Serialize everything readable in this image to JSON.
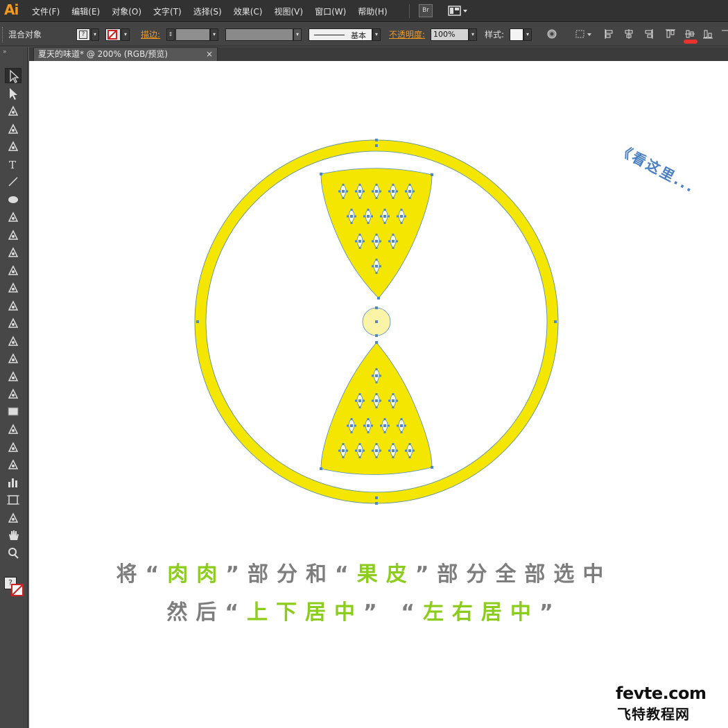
{
  "app": {
    "logo": "Ai",
    "menus": [
      "文件(F)",
      "编辑(E)",
      "对象(O)",
      "文字(T)",
      "选择(S)",
      "效果(C)",
      "视图(V)",
      "窗口(W)",
      "帮助(H)"
    ],
    "bridge_label": "Br"
  },
  "control": {
    "selection_label": "混合对象",
    "stroke_label": "描边:",
    "stroke_profile": "基本",
    "opacity_label": "不透明度:",
    "opacity_value": "100%",
    "style_label": "样式:"
  },
  "document": {
    "tab_title": "夏天的味道* @ 200% (RGB/预览)",
    "close_glyph": "×"
  },
  "tools": [
    "selection",
    "direct-selection",
    "magic-wand",
    "lasso",
    "pen",
    "type",
    "line-segment",
    "ellipse",
    "paintbrush",
    "pencil",
    "blob-brush",
    "eraser",
    "rotate",
    "scale",
    "warp",
    "free-transform",
    "shape-builder",
    "perspective-grid",
    "mesh",
    "gradient",
    "eyedropper",
    "blend",
    "symbol-sprayer",
    "column-graph",
    "artboard",
    "slice",
    "hand",
    "zoom"
  ],
  "annotation": "《看这里...",
  "captions": {
    "line1": {
      "pre": "将“",
      "g1": "肉肉",
      "mid": "”部分和“",
      "g2": "果皮",
      "post": "”部分全部选中"
    },
    "line2": {
      "pre": "然后“",
      "g1": "上下居中",
      "mid": "” “",
      "g2": "左右居中",
      "post": "”"
    }
  },
  "watermark": {
    "line1": "fevte.com",
    "line2": "飞特教程网"
  },
  "colors": {
    "lemon": "#f5e600",
    "center": "#fbf3a6",
    "anchor": "#4d88c8",
    "highlight": "#8ccc1d",
    "mark": "#e8322d"
  }
}
